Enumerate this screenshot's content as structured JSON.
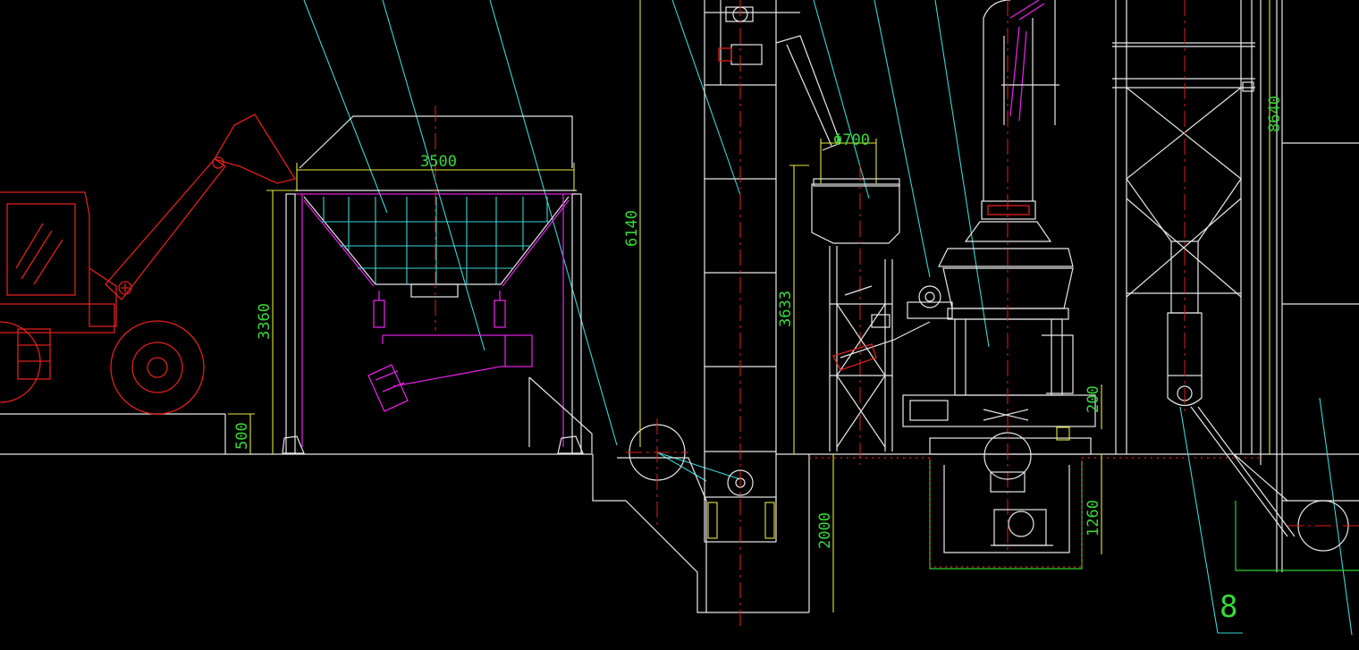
{
  "drawing": {
    "background": "#000000",
    "colors": {
      "outline": "#e8e8e8",
      "loader": "#e0201c",
      "leader": "#39d6d6",
      "feeder": "#e020e0",
      "dimension_line": "#e6e640",
      "dimension_text": "#38d838"
    },
    "dimensions": {
      "hopper_width": "3500",
      "hopper_frame_height": "3360",
      "ramp_height": "500",
      "elevator_height": "6140",
      "feed_hopper_diameter": "Φ700",
      "mill_frame_height": "3633",
      "pit_depth": "2000",
      "motor_pit_depth": "1260",
      "mill_base_offset": "200",
      "dust_collector_height": "8640"
    },
    "labels": {
      "balloon_number": "8"
    }
  }
}
